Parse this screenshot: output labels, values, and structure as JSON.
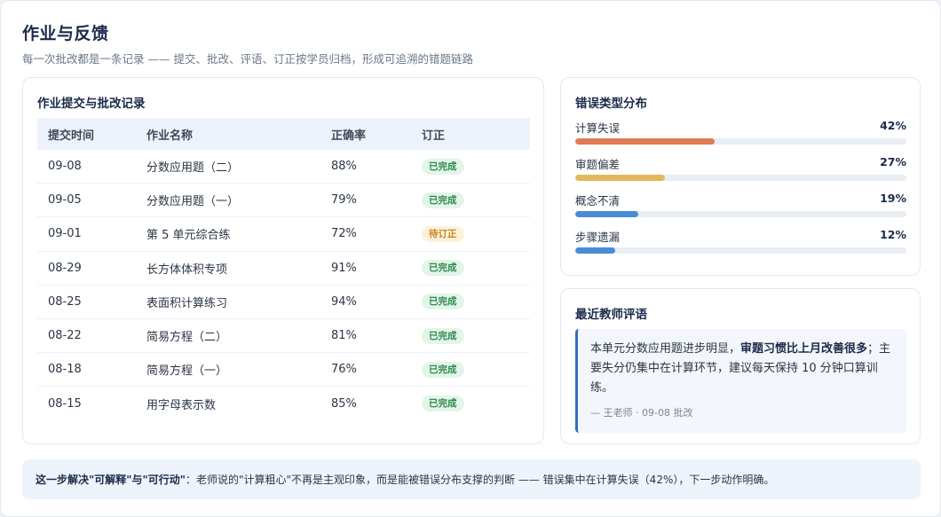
{
  "header": {
    "title": "作业与反馈",
    "subtitle": "每一次批改都是一条记录 —— 提交、批改、评语、订正按学员归档，形成可追溯的错题链路"
  },
  "records": {
    "title": "作业提交与批改记录",
    "columns": [
      "提交时间",
      "作业名称",
      "正确率",
      "订正"
    ],
    "rows": [
      {
        "date": "09-08",
        "name": "分数应用题（二）",
        "rate": "88%",
        "status": "已完成",
        "state": "done"
      },
      {
        "date": "09-05",
        "name": "分数应用题（一）",
        "rate": "79%",
        "status": "已完成",
        "state": "done"
      },
      {
        "date": "09-01",
        "name": "第 5 单元综合练",
        "rate": "72%",
        "status": "待订正",
        "state": "pending"
      },
      {
        "date": "08-29",
        "name": "长方体体积专项",
        "rate": "91%",
        "status": "已完成",
        "state": "done"
      },
      {
        "date": "08-25",
        "name": "表面积计算练习",
        "rate": "94%",
        "status": "已完成",
        "state": "done"
      },
      {
        "date": "08-22",
        "name": "简易方程（二）",
        "rate": "81%",
        "status": "已完成",
        "state": "done"
      },
      {
        "date": "08-18",
        "name": "简易方程（一）",
        "rate": "76%",
        "status": "已完成",
        "state": "done"
      },
      {
        "date": "08-15",
        "name": "用字母表示数",
        "rate": "85%",
        "status": "已完成",
        "state": "done"
      }
    ]
  },
  "errors": {
    "title": "错误类型分布",
    "items": [
      {
        "label": "计算失误",
        "pct_text": "42%",
        "value": 42,
        "color": "#e07a55"
      },
      {
        "label": "审题偏差",
        "pct_text": "27%",
        "value": 27,
        "color": "#e3b85a"
      },
      {
        "label": "概念不清",
        "pct_text": "19%",
        "value": 19,
        "color": "#4a8bd6"
      },
      {
        "label": "步骤遗漏",
        "pct_text": "12%",
        "value": 12,
        "color": "#4a8bd6"
      }
    ]
  },
  "comment": {
    "title": "最近教师评语",
    "text_before": "本单元分数应用题进步明显，",
    "text_bold": "审题习惯比上月改善很多",
    "text_after": "；主要失分仍集中在计算环节，建议每天保持 10 分钟口算训练。",
    "signature": "— 王老师 · 09-08 批改"
  },
  "footer": {
    "bold": "这一步解决\"可解释\"与\"可行动\"",
    "text": "：老师说的\"计算粗心\"不再是主观印象，而是能被错误分布支撑的判断 —— 错误集中在计算失误（42%），下一步动作明确。"
  }
}
